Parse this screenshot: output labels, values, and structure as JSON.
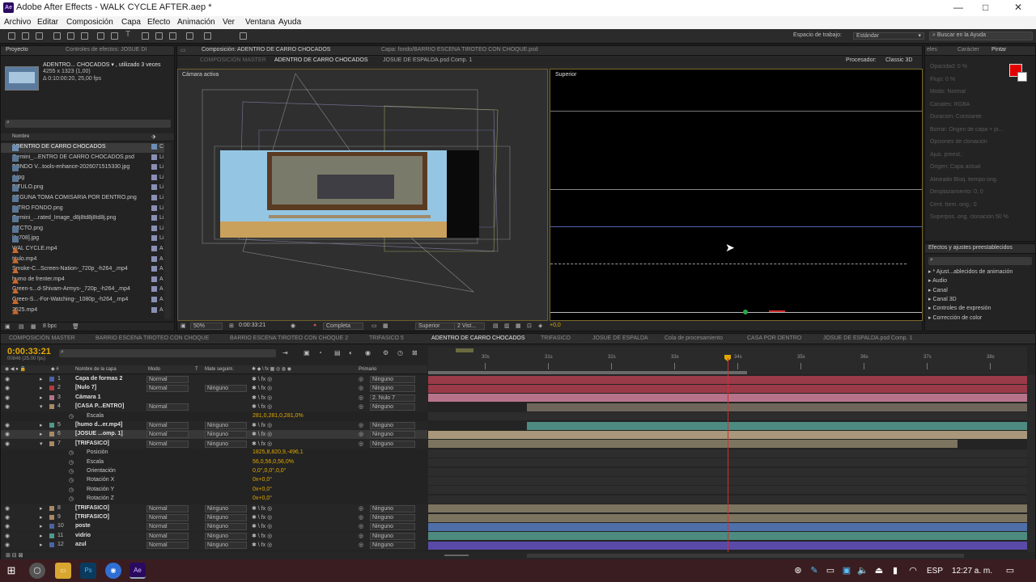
{
  "window": {
    "title": "Adobe After Effects - WALK CYCLE AFTER.aep *",
    "app_icon": "Ae"
  },
  "menu": [
    "Archivo",
    "Editar",
    "Composición",
    "Capa",
    "Efecto",
    "Animación",
    "Ver",
    "Ventana",
    "Ayuda"
  ],
  "toolbar": {
    "workspace_label": "Espacio de trabajo:",
    "workspace_value": "Estándar",
    "search_placeholder": "Buscar en la Ayuda"
  },
  "project": {
    "tab": "Proyecto",
    "tab2": "Controles de efectos: JOSUE DI",
    "selected_name": "ADENTRO... CHOCADOS ▾ , utilizado 3 veces",
    "dims": "4255 x 1323 (1,00)",
    "duration": "Δ 0:10:00:20, 25,00 fps",
    "search_icon": "search-icon",
    "col_name": "Nombre",
    "bpc": "8 bpc",
    "items": [
      {
        "name": "ADENTRO DE CARRO CHOCADOS",
        "type": "comp",
        "color": "#6b8fb5",
        "flag": "C"
      },
      {
        "name": "Gemini_...ENTRO DE CARRO CHOCADOS.psd",
        "type": "img",
        "color": "#8a8fb5",
        "flag": "Li"
      },
      {
        "name": "FONDO V...tools-enhance-2026071515330.jpg",
        "type": "img",
        "color": "#8a8fb5",
        "flag": "Li"
      },
      {
        "name": "4.jpg",
        "type": "img",
        "color": "#8a8fb5",
        "flag": "Li"
      },
      {
        "name": "TITULO.png",
        "type": "img",
        "color": "#8a8fb5",
        "flag": "Li"
      },
      {
        "name": "SEGUNA TOMA COMISARIA POR DENTRO.png",
        "type": "img",
        "color": "#8a8fb5",
        "flag": "Li"
      },
      {
        "name": "INTRO FONDO.png",
        "type": "img",
        "color": "#8a8fb5",
        "flag": "Li"
      },
      {
        "name": "Gemini_...rated_Image_d8j8td8j8td8j.png",
        "type": "img",
        "color": "#8a8fb5",
        "flag": "Li"
      },
      {
        "name": "CECTO.png",
        "type": "img",
        "color": "#8a8fb5",
        "flag": "Li"
      },
      {
        "name": "[1-708].jpg",
        "type": "img",
        "color": "#8a8fb5",
        "flag": "Li"
      },
      {
        "name": "WAL CYCLE.mp4",
        "type": "vid",
        "color": "#8a8fb5",
        "flag": "A"
      },
      {
        "name": "titulo.mp4",
        "type": "vid",
        "color": "#8a8fb5",
        "flag": "A"
      },
      {
        "name": "Smoke-C...Screen-Nation-_720p_-h264_.mp4",
        "type": "vid",
        "color": "#8a8fb5",
        "flag": "A"
      },
      {
        "name": "humo de frenter.mp4",
        "type": "vid",
        "color": "#8a8fb5",
        "flag": "A"
      },
      {
        "name": "Green-s...d-Shivam-Armys-_720p_-h264_.mp4",
        "type": "vid",
        "color": "#8a8fb5",
        "flag": "A"
      },
      {
        "name": "Green-S...-For-Watching-_1080p_-h264_.mp4",
        "type": "vid",
        "color": "#8a8fb5",
        "flag": "A"
      },
      {
        "name": "2525.mp4",
        "type": "vid",
        "color": "#8a8fb5",
        "flag": "A"
      }
    ]
  },
  "viewer": {
    "tab": "Composición: ADENTRO DE CARRO CHOCADOS",
    "tab_layer": "Capa: fondo/BARRIO ESCENA TIROTEO CON CHOQUE.psd",
    "sub_tabs": [
      "COMPOSICIÓN MASTER",
      "ADENTRO DE CARRO CHOCADOS",
      "JOSUE DE ESPALDA.psd Comp. 1"
    ],
    "renderer": "Procesador:",
    "renderer_value": "Classic 3D",
    "left_label": "Cámara activa",
    "right_label": "Superior",
    "footer": {
      "zoom": "50%",
      "time": "0:00:33:21",
      "quality": "Completa",
      "view": "Superior",
      "views": "2 Vist...",
      "exposure": "+0,0"
    }
  },
  "right_panel": {
    "tabs": [
      "eles",
      "Carácter",
      "Pintar"
    ],
    "color": "#e00000",
    "rows": [
      "Opacidad: 0 %",
      "Flujo: 0 %",
      "Modo: Normal",
      "Canales: RGBA",
      "Duración: Constante",
      "Borrar: Origen de capa + pi...",
      "Opciones de clonación",
      "Ajus. preest.:",
      "Origen: Capa actual",
      "Alineado   Bloq. tiempo orig.",
      "Desplazamiento: 0, 0",
      "Cent. hem. orig.: 0",
      "Superpos. orig. clonación 50 %"
    ],
    "effects_title": "Efectos y ajustes preestablecidos",
    "effects": [
      "* Ajust...ablecidos de animación",
      "Audio",
      "Canal",
      "Canal 3D",
      "Controles de expresión",
      "Corrección de color"
    ]
  },
  "timeline": {
    "tabs": [
      "COMPOSICIÓN MASTER",
      "BARRIO ESCENA TIROTEO CON CHOQUE",
      "BARRIO ESCENA TIROTEO CON CHOQUE 2",
      "TRIFASICO 5",
      "ADENTRO DE CARRO CHOCADOS",
      "TRIFASICO",
      "JOSUE DE ESPALDA",
      "Cola de procesamiento",
      "CASA POR DENTRO",
      "JOSUE DE ESPALDA.psd Comp. 1"
    ],
    "time": "0:00:33:21",
    "frames": "00846 (25.00 fps)",
    "col_layer": "Nombre de la capa",
    "col_mode": "Modo",
    "col_t": "T",
    "col_matte": "Mate seguim.",
    "col_parent": "Primario",
    "ruler": [
      "30s",
      "31s",
      "32s",
      "33s",
      "34s",
      "35s",
      "36s",
      "37s",
      "38s"
    ],
    "rows": [
      {
        "num": "1",
        "name": "Capa de formas 2",
        "mode": "Normal",
        "matte": "",
        "parent": "Ninguno",
        "color": "#4b63a6",
        "bar": "#9b3a49",
        "kind": "layer"
      },
      {
        "num": "2",
        "name": "[Nulo 7]",
        "mode": "Normal",
        "matte": "Ninguno",
        "parent": "Ninguno",
        "color": "#b23b3b",
        "bar": "#9b3a49",
        "kind": "layer"
      },
      {
        "num": "3",
        "name": "Cámara 1",
        "mode": "",
        "matte": "",
        "parent": "2. Nulo 7",
        "color": "#b7738a",
        "bar": "#b7738a",
        "kind": "layer"
      },
      {
        "num": "4",
        "name": "[CASA P...ENTRO]",
        "mode": "Normal",
        "matte": "",
        "parent": "Ninguno",
        "color": "#a88a66",
        "bar": "#6e665a",
        "kind": "layer"
      },
      {
        "num": "",
        "name": "Escala",
        "value": "281,0,281,0,281,0%",
        "kind": "prop"
      },
      {
        "num": "5",
        "name": "[humo d...er.mp4]",
        "mode": "Normal",
        "matte": "Ninguno",
        "parent": "Ninguno",
        "color": "#4d9a8c",
        "bar": "#4d8a80",
        "kind": "layer"
      },
      {
        "num": "6",
        "name": "[JOSUE ...omp. 1]",
        "mode": "Normal",
        "matte": "Ninguno",
        "parent": "Ninguno",
        "color": "#a88a66",
        "bar": "#a8977a",
        "kind": "layer"
      },
      {
        "num": "7",
        "name": "[TRIFASICO]",
        "mode": "Normal",
        "matte": "Ninguno",
        "parent": "Ninguno",
        "color": "#a88a66",
        "bar": "#7d7460",
        "kind": "layer"
      },
      {
        "num": "",
        "name": "Posición",
        "value": "1825,8,820,9,-496,1",
        "kind": "prop"
      },
      {
        "num": "",
        "name": "Escala",
        "value": "56,0,56,0,56,0%",
        "kind": "prop"
      },
      {
        "num": "",
        "name": "Orientación",
        "value": "0,0°,0,0°,0,0°",
        "kind": "prop"
      },
      {
        "num": "",
        "name": "Rotación X",
        "value": "0x+0,0°",
        "kind": "prop"
      },
      {
        "num": "",
        "name": "Rotación Y",
        "value": "0x+0,0°",
        "kind": "prop"
      },
      {
        "num": "",
        "name": "Rotación Z",
        "value": "0x+0,0°",
        "kind": "prop"
      },
      {
        "num": "8",
        "name": "[TRIFASICO]",
        "mode": "Normal",
        "matte": "Ninguno",
        "parent": "Ninguno",
        "color": "#a88a66",
        "bar": "#7d7460",
        "kind": "layer"
      },
      {
        "num": "9",
        "name": "[TRIFASICO]",
        "mode": "Normal",
        "matte": "Ninguno",
        "parent": "Ninguno",
        "color": "#a88a66",
        "bar": "#7d7460",
        "kind": "layer"
      },
      {
        "num": "10",
        "name": "poste",
        "mode": "Normal",
        "matte": "Ninguno",
        "parent": "Ninguno",
        "color": "#4b63a6",
        "bar": "#4e6fa8",
        "kind": "layer"
      },
      {
        "num": "11",
        "name": "vidrio",
        "mode": "Normal",
        "matte": "Ninguno",
        "parent": "Ninguno",
        "color": "#4d9a8c",
        "bar": "#4d8a80",
        "kind": "layer"
      },
      {
        "num": "12",
        "name": "azul",
        "mode": "Normal",
        "matte": "Ninguno",
        "parent": "Ninguno",
        "color": "#4b63a6",
        "bar": "#5a4aa8",
        "kind": "layer"
      }
    ]
  },
  "taskbar": {
    "lang": "ESP",
    "clock": "12:27 a. m."
  }
}
